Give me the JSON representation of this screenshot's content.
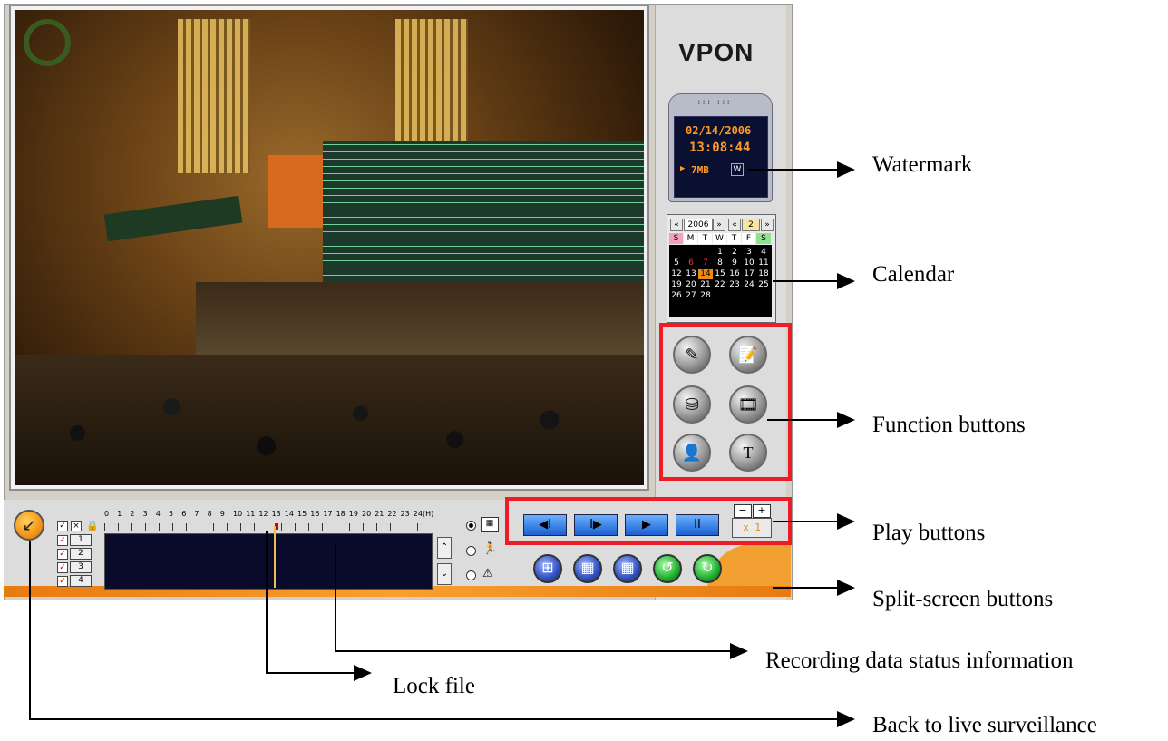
{
  "app": {
    "brand": "VPON",
    "clock": {
      "date": "02/14/2006",
      "time": "13:08:44",
      "disk": "7MB",
      "watermark_badge": "W"
    },
    "calendar": {
      "year": "2006",
      "month": "2",
      "prev_year": "«",
      "next_year": "»",
      "prev_month": "«",
      "next_month": "»",
      "weekdays": [
        "S",
        "M",
        "T",
        "W",
        "T",
        "F",
        "S"
      ],
      "days": [
        "1",
        "2",
        "3",
        "4",
        "5",
        "6",
        "7",
        "8",
        "9",
        "10",
        "11",
        "12",
        "13",
        "14",
        "15",
        "16",
        "17",
        "18",
        "19",
        "20",
        "21",
        "22",
        "23",
        "24",
        "25",
        "26",
        "27",
        "28"
      ],
      "selected_day": "14"
    },
    "function_buttons": [
      "edit-icon",
      "notes-icon",
      "disk-icon",
      "film-icon",
      "user-icon",
      "text-icon"
    ],
    "play": {
      "buttons": [
        "◀Ⅰ",
        "Ⅰ▶",
        "▶",
        "ⅠⅠ"
      ],
      "speed": "x 1",
      "minus": "−",
      "plus": "+"
    },
    "split": {
      "buttons": [
        "⊞",
        "▦",
        "▦"
      ],
      "rotate_left": "↺",
      "rotate_right": "↻"
    },
    "timeline": {
      "hours": [
        "0",
        "1",
        "2",
        "3",
        "4",
        "5",
        "6",
        "7",
        "8",
        "9",
        "10",
        "11",
        "12",
        "13",
        "14",
        "15",
        "16",
        "17",
        "18",
        "19",
        "20",
        "21",
        "22",
        "23",
        "24"
      ],
      "unit": "(H)",
      "channels": [
        "1",
        "2",
        "3",
        "4"
      ]
    }
  },
  "annotations": {
    "watermark": "Watermark",
    "calendar": "Calendar",
    "function_buttons": "Function buttons",
    "play_buttons": "Play buttons",
    "split_screen": "Split-screen buttons",
    "recording_status": "Recording data status information",
    "lock_file": "Lock file",
    "back_live": "Back to live surveillance"
  },
  "colors": {
    "highlight": "#ee1c25",
    "accent": "#f08a10",
    "lcd": "#ff9a2a"
  }
}
